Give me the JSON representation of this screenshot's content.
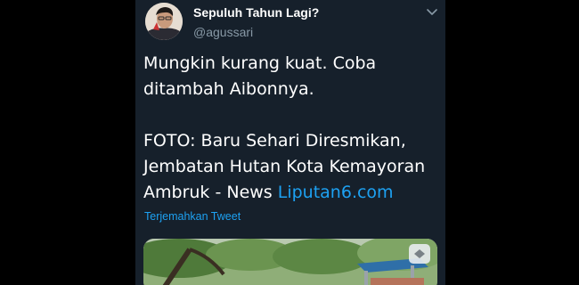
{
  "tweet": {
    "display_name": "Sepuluh Tahun Lagi?",
    "handle": "@agussari",
    "text_lines": [
      "Mungkin kurang kuat. Coba",
      "ditambah Aibonnya.",
      "",
      "FOTO: Baru Sehari Diresmikan,",
      "Jembatan Hutan Kota Kemayoran"
    ],
    "last_line_text": "Ambruk - News ",
    "link_text": "Liputan6.com",
    "translate_label": "Terjemahkan Tweet"
  },
  "icons": {
    "menu": "chevron-down-icon",
    "avatar": "profile-photo",
    "media": "bridge-photo"
  },
  "colors": {
    "card_background": "#16202b",
    "link": "#1da1f2",
    "secondary_text": "#8899a6"
  }
}
